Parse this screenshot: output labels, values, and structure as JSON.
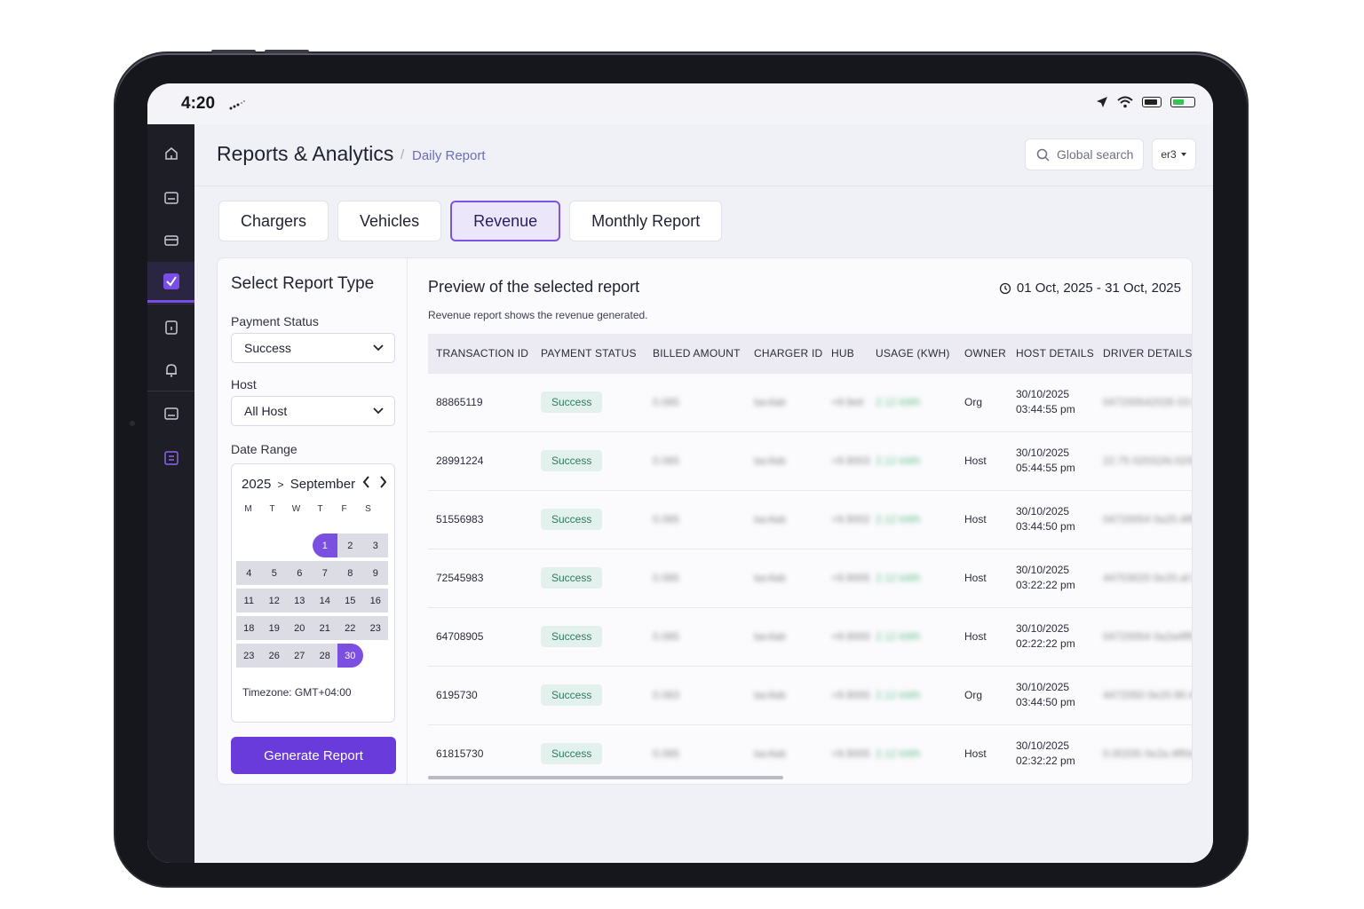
{
  "status_bar": {
    "time": "4:20"
  },
  "header": {
    "title": "Reports & Analytics",
    "separator": "/",
    "breadcrumb": "Daily Report",
    "search_placeholder": "Global search",
    "user_label": "er3"
  },
  "tabs": [
    {
      "label": "Chargers"
    },
    {
      "label": "Vehicles"
    },
    {
      "label": "Revenue",
      "active": true
    },
    {
      "label": "Monthly Report"
    }
  ],
  "left_panel": {
    "title": "Select Report Type",
    "payment_status_label": "Payment Status",
    "payment_status_value": "Success",
    "host_label": "Host",
    "host_value": "All Host",
    "date_range_label": "Date Range",
    "calendar": {
      "year": "2025",
      "month": "September",
      "chevron": ">",
      "weekdays": [
        "M",
        "T",
        "W",
        "T",
        "F",
        "S"
      ],
      "weeks": [
        [
          "",
          "",
          "",
          "1",
          "2",
          "3"
        ],
        [
          "4",
          "5",
          "6",
          "7",
          "8",
          "9"
        ],
        [
          "11",
          "12",
          "13",
          "14",
          "15",
          "16"
        ],
        [
          "18",
          "19",
          "20",
          "21",
          "22",
          "23"
        ],
        [
          "23",
          "26",
          "27",
          "28",
          "30",
          ""
        ]
      ],
      "selected_start": "1",
      "selected_end": "30"
    },
    "timezone": "Timezone: GMT+04:00",
    "generate_button": "Generate Report"
  },
  "preview": {
    "title": "Preview of the selected report",
    "date_range": "01 Oct, 2025 - 31 Oct, 2025",
    "description": "Revenue report shows the revenue generated.",
    "columns": [
      "TRANSACTION ID",
      "PAYMENT STATUS",
      "BILLED AMOUNT",
      "CHARGER ID",
      "HUB",
      "USAGE (KWH)",
      "OWNER",
      "HOST DETAILS",
      "DRIVER DETAILS"
    ],
    "rows": [
      {
        "transaction_id": "88865119",
        "status": "Success",
        "billed": "0.085",
        "charger": "tac4ab",
        "hub": "+9.9eit",
        "usage": "2.12 kWh",
        "owner": "Org",
        "date": "30/10/2025",
        "time": "03:44:55 pm",
        "driver1": "04720054",
        "driver2": "2026 03:00"
      },
      {
        "transaction_id": "28991224",
        "status": "Success",
        "billed": "0.085",
        "charger": "tac4ab",
        "hub": "+9.9003",
        "usage": "2.12 kWh",
        "owner": "Host",
        "date": "30/10/2025",
        "time": "05:44:55 pm",
        "driver1": "22.75 0203",
        "driver2": "2Al.02008"
      },
      {
        "transaction_id": "51556983",
        "status": "Success",
        "billed": "0.085",
        "charger": "tac4ab",
        "hub": "+9.9002",
        "usage": "2.12 kWh",
        "owner": "Host",
        "date": "30/10/2025",
        "time": "03:44:50 pm",
        "driver1": "04720054 0a",
        "driver2": "20.4ff0ma"
      },
      {
        "transaction_id": "72545983",
        "status": "Success",
        "billed": "0.085",
        "charger": "tac4ab",
        "hub": "+9.9005",
        "usage": "2.12 kWh",
        "owner": "Host",
        "date": "30/10/2025",
        "time": "03:22:22 pm",
        "driver1": "44703020 0e",
        "driver2": "20.af.0ma"
      },
      {
        "transaction_id": "64708905",
        "status": "Success",
        "billed": "0.085",
        "charger": "tac4ab",
        "hub": "+9.9000",
        "usage": "2.12 kWh",
        "owner": "Host",
        "date": "30/10/2025",
        "time": "02:22:22 pm",
        "driver1": "04720054 0a",
        "driver2": "2a4ff0ma"
      },
      {
        "transaction_id": "6195730",
        "status": "Success",
        "billed": "0.083",
        "charger": "tac4ab",
        "hub": "+9.9000",
        "usage": "2.12 kWh",
        "owner": "Org",
        "date": "30/10/2025",
        "time": "03:44:50 pm",
        "driver1": "4472050 0e",
        "driver2": "20.90.40"
      },
      {
        "transaction_id": "61815730",
        "status": "Success",
        "billed": "0.085",
        "charger": "tac4ab",
        "hub": "+9.9005",
        "usage": "2.12 kWh",
        "owner": "Host",
        "date": "30/10/2025",
        "time": "02:32:22 pm",
        "driver1": "0.00205 0e",
        "driver2": "2a.4ff0ma"
      }
    ]
  },
  "colors": {
    "accent": "#6a3bdb",
    "success_bg": "#e2f1ec",
    "success_text": "#2f7a5c",
    "rail_bg": "#1e1e27"
  }
}
